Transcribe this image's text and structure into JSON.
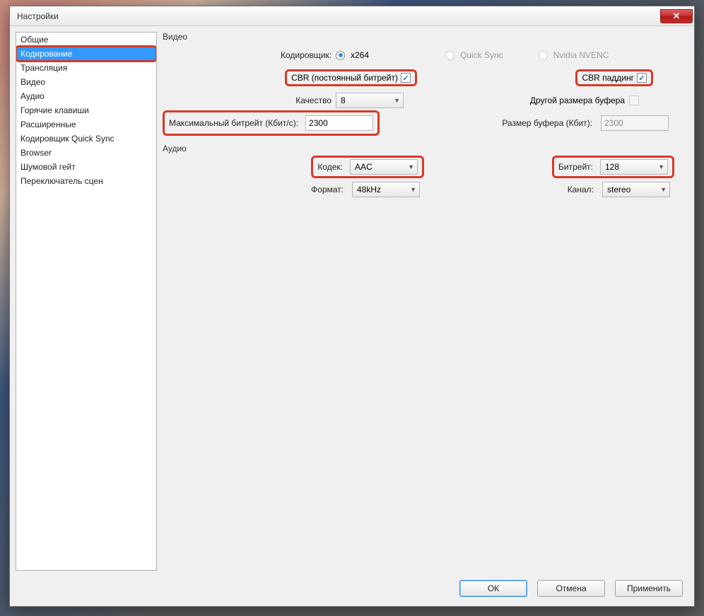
{
  "window": {
    "title": "Настройки"
  },
  "sidebar": {
    "items": [
      {
        "label": "Общие"
      },
      {
        "label": "Кодирование"
      },
      {
        "label": "Трансляция"
      },
      {
        "label": "Видео"
      },
      {
        "label": "Аудио"
      },
      {
        "label": "Горячие клавиши"
      },
      {
        "label": "Расширенные"
      },
      {
        "label": "Кодировщик Quick Sync"
      },
      {
        "label": "Browser"
      },
      {
        "label": "Шумовой гейт"
      },
      {
        "label": "Переключатель сцен"
      }
    ],
    "selected_index": 1
  },
  "video_group": {
    "title": "Видео",
    "encoder_label": "Кодировщик:",
    "encoder_options": {
      "x264": "x264",
      "quicksync": "Quick Sync",
      "nvenc": "Nvidia NVENC"
    },
    "cbr_label": "CBR (постоянный битрейт)",
    "cbr_padding_label": "CBR паддинг",
    "quality_label": "Качество",
    "quality_value": "8",
    "other_buffer_label": "Другой размера буфера",
    "max_bitrate_label": "Максимальный битрейт (Кбит/с):",
    "max_bitrate_value": "2300",
    "buffer_size_label": "Размер буфера (Кбит):",
    "buffer_size_value": "2300"
  },
  "audio_group": {
    "title": "Аудио",
    "codec_label": "Кодек:",
    "codec_value": "AAC",
    "bitrate_label": "Битрейт:",
    "bitrate_value": "128",
    "format_label": "Формат:",
    "format_value": "48kHz",
    "channel_label": "Канал:",
    "channel_value": "stereo"
  },
  "buttons": {
    "ok": "ОК",
    "cancel": "Отмена",
    "apply": "Применить"
  }
}
